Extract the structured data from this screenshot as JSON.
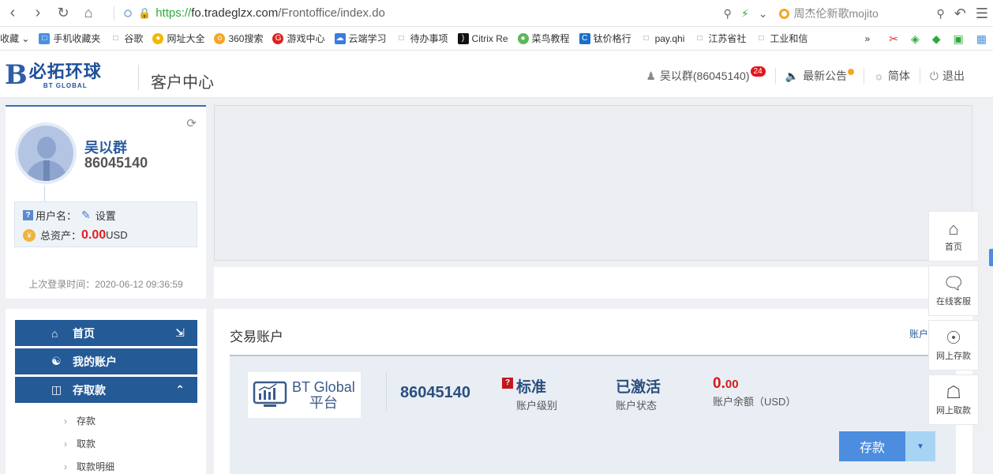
{
  "browser": {
    "url_scheme": "https://",
    "url_host": "fo.tradeglzx.com",
    "url_path": "/Frontoffice/index.do",
    "search_text": "周杰伦新歌mojito"
  },
  "bookmarks": {
    "favorites_label": "收藏",
    "items": [
      "手机收藏夹",
      "谷歌",
      "网址大全",
      "360搜索",
      "游戏中心",
      "云端学习",
      "待办事项",
      "Citrix Re",
      "菜鸟教程",
      "钛价格行",
      "pay.qhi",
      "江苏省社",
      "工业和信"
    ],
    "more": "»"
  },
  "header": {
    "logo_cn": "必拓环球",
    "logo_en": "BT GLOBAL",
    "title": "客户中心",
    "user": "吴以群(86045140)",
    "user_badge": "24",
    "announcements": "最新公告",
    "language": "简体",
    "logout": "退出"
  },
  "profile": {
    "name": "吴以群",
    "account_id": "86045140",
    "username_label": "用户名：",
    "settings_label": "设置",
    "total_assets_label": "总资产：",
    "total_assets_value": "0.00",
    "currency": "USD",
    "last_login": "上次登录时间：2020-06-12 09:36:59"
  },
  "menu": {
    "home": "首页",
    "my_account": "我的账户",
    "deposit_withdraw": "存取款",
    "sub_items": [
      "存款",
      "取款",
      "取款明细"
    ]
  },
  "trading": {
    "title": "交易账户",
    "link": "账户",
    "platform_line1": "BT Global",
    "platform_line2": "平台",
    "account_number": "86045140",
    "level_value": "标准",
    "level_label": "账户级别",
    "status_value": "已激活",
    "status_label": "账户状态",
    "balance_int": "0.",
    "balance_dec": "00",
    "balance_label": "账户余额（USD）",
    "deposit_button": "存款"
  },
  "float_tools": [
    "首页",
    "在线客服",
    "网上存款",
    "网上取款"
  ],
  "colors": {
    "brand_blue": "#245a96",
    "accent_red": "#e02020",
    "button_blue": "#4c8de0"
  }
}
